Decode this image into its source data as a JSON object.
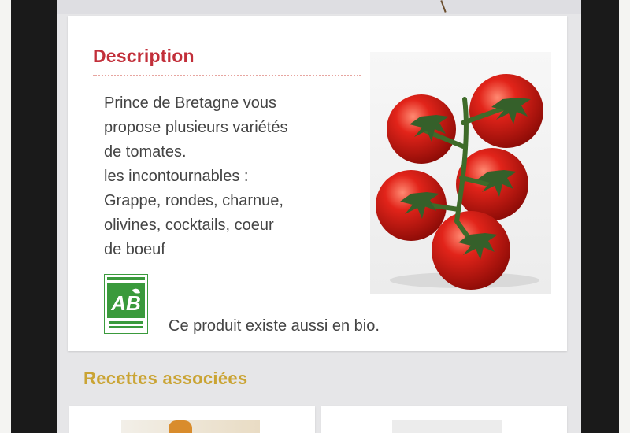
{
  "description": {
    "title": "Description",
    "lines": [
      "Prince de Bretagne vous",
      "propose plusieurs variétés",
      "de tomates.",
      "les incontournables :",
      "Grappe, rondes, charnue,",
      "olivines, cocktails, coeur",
      "de boeuf"
    ],
    "bio_logo_text": "AB",
    "bio_note": "Ce produit existe aussi en bio."
  },
  "recipes": {
    "title": "Recettes associées"
  },
  "colors": {
    "description_title": "#c22f3a",
    "recipes_title": "#caa434",
    "bio_green": "#3a9a3c"
  }
}
